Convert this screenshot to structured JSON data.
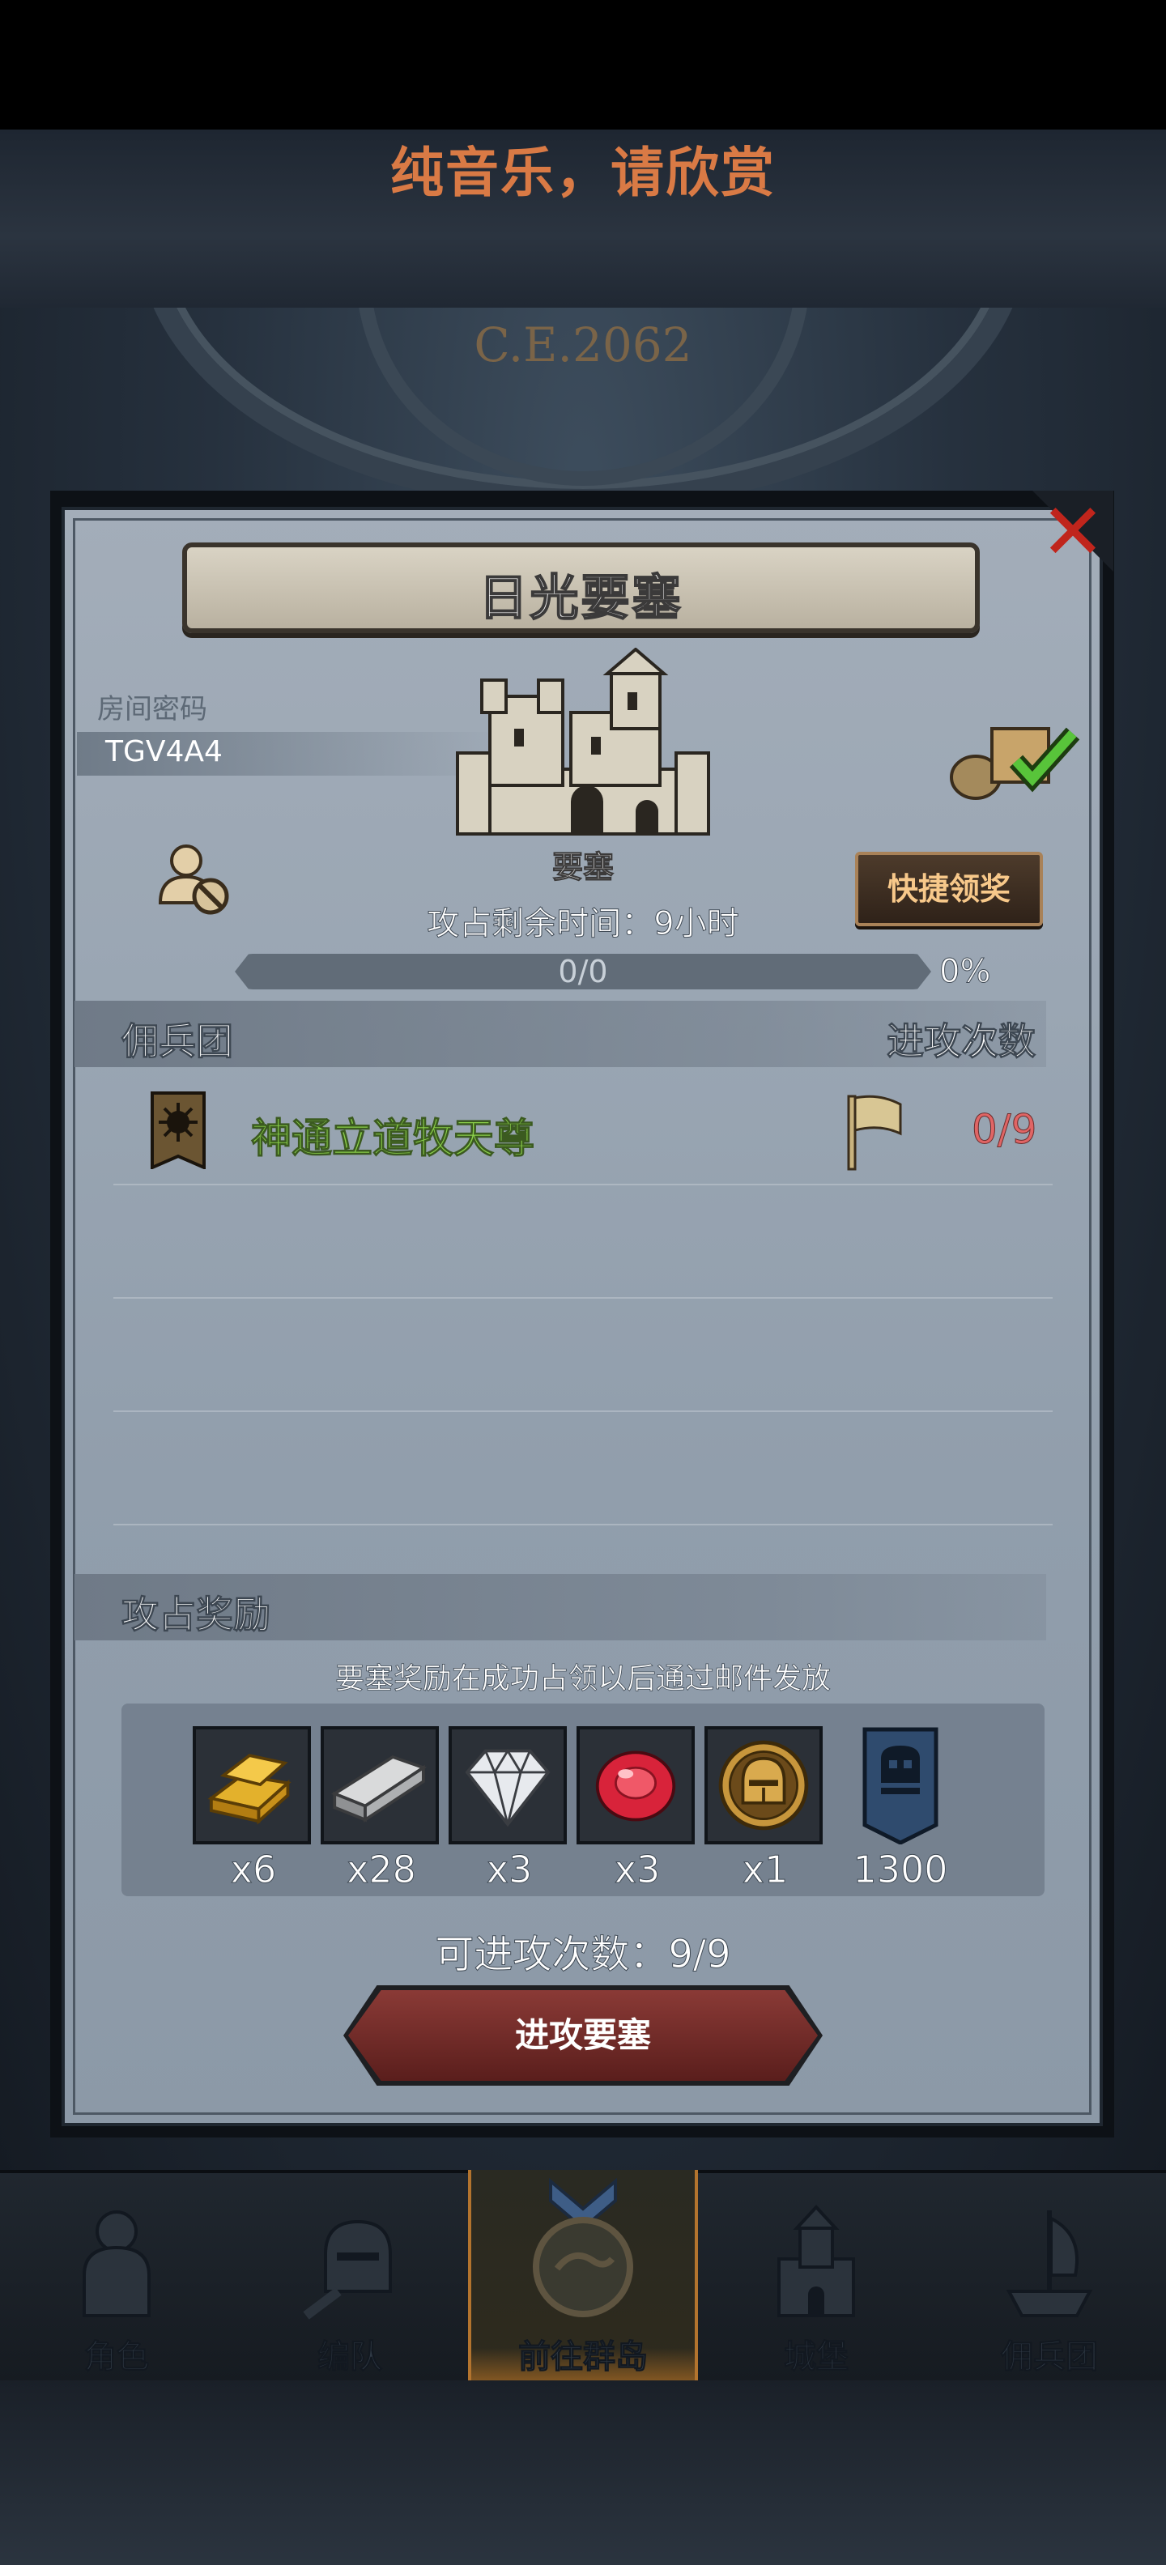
{
  "banner": {
    "text": "纯音乐，请欣赏"
  },
  "scene": {
    "era_text": "C.E.2062"
  },
  "panel": {
    "title": "日光要塞",
    "room_code_label": "房间密码",
    "room_code": "TGV4A4",
    "fortress_label": "要塞",
    "quick_claim_label": "快捷领奖",
    "time_left": "攻占剩余时间：9小时",
    "progress": {
      "current": 0,
      "total": 0,
      "text": "0/0",
      "percent_text": "0%"
    }
  },
  "mercenary_section": {
    "header_left": "佣兵团",
    "header_right": "进攻次数",
    "rows": [
      {
        "name": "神通立道牧天尊",
        "attacks": "0/9",
        "name_color": "#8bd04a"
      }
    ]
  },
  "reward_section": {
    "header": "攻占奖励",
    "note": "要塞奖励在成功占领以后通过邮件发放",
    "items": [
      {
        "icon": "gold-bar-icon",
        "qty": "x6"
      },
      {
        "icon": "iron-ingot-icon",
        "qty": "x28"
      },
      {
        "icon": "diamond-icon",
        "qty": "x3"
      },
      {
        "icon": "ruby-icon",
        "qty": "x3"
      },
      {
        "icon": "knight-helmet-coin-icon",
        "qty": "x1"
      },
      {
        "icon": "guild-banner-icon",
        "qty": "1300"
      }
    ]
  },
  "attacks_left": "可进攻次数：9/9",
  "attack_button": "进攻要塞",
  "bottom_nav": [
    {
      "label": "角色",
      "icon": "knight-icon",
      "active": false
    },
    {
      "label": "编队",
      "icon": "helmet-team-icon",
      "active": false
    },
    {
      "label": "前往群岛",
      "icon": "island-compass-icon",
      "active": true
    },
    {
      "label": "城堡",
      "icon": "castle-icon",
      "active": false
    },
    {
      "label": "佣兵团",
      "icon": "mercenary-ship-icon",
      "active": false
    }
  ],
  "colors": {
    "accent_orange": "#d97a45",
    "attack_count_red": "#e06565",
    "attack_button": "#8a3a36"
  }
}
